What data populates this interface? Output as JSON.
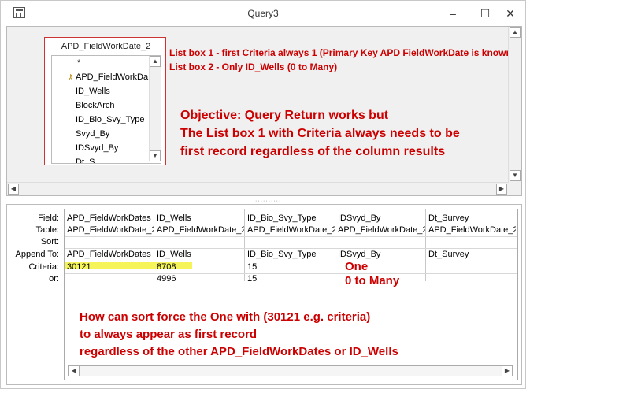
{
  "window": {
    "title": "Query3",
    "controls": {
      "minimize": "–",
      "maximize": "☐",
      "close": "✕"
    }
  },
  "table": {
    "name": "APD_FieldWorkDate_2",
    "fields": [
      {
        "label": "*",
        "icon": ""
      },
      {
        "label": "APD_FieldWorkDa",
        "icon": "key-icon"
      },
      {
        "label": "ID_Wells",
        "icon": ""
      },
      {
        "label": "BlockArch",
        "icon": ""
      },
      {
        "label": "ID_Bio_Svy_Type",
        "icon": ""
      },
      {
        "label": "Svyd_By",
        "icon": ""
      },
      {
        "label": "IDSvyd_By",
        "icon": ""
      },
      {
        "label": "Dt_S...",
        "icon": ""
      }
    ]
  },
  "notes": {
    "line1": "List box 1 - first Criteria always 1 (Primary Key APD FieldWorkDate is known",
    "line2": "List box 2 - Only ID_Wells (0 to Many)",
    "objective1": "Objective: Query Return works but",
    "objective2": "The List box 1 with Criteria always needs to be",
    "objective3": "first record regardless of the column results",
    "one": "One",
    "zero_to_many": "0 to Many",
    "question1": "How can sort force the One with (30121 e.g. criteria)",
    "question2": "to always appear as first record",
    "question3": "regardless of the other APD_FieldWorkDates or ID_Wells"
  },
  "grid": {
    "row_labels": [
      "Field:",
      "Table:",
      "Sort:",
      "Append To:",
      "Criteria:",
      "or:"
    ],
    "columns": [
      {
        "field": "APD_FieldWorkDates",
        "table": "APD_FieldWorkDate_2",
        "sort": "",
        "append": "APD_FieldWorkDates",
        "criteria": "30121",
        "or": ""
      },
      {
        "field": "ID_Wells",
        "table": "APD_FieldWorkDate_2",
        "sort": "",
        "append": "ID_Wells",
        "criteria": "8708",
        "or": "4996"
      },
      {
        "field": "ID_Bio_Svy_Type",
        "table": "APD_FieldWorkDate_2",
        "sort": "",
        "append": "ID_Bio_Svy_Type",
        "criteria": "15",
        "or": "15"
      },
      {
        "field": "IDSvyd_By",
        "table": "APD_FieldWorkDate_2",
        "sort": "",
        "append": "IDSvyd_By",
        "criteria": "",
        "or": ""
      },
      {
        "field": "Dt_Survey",
        "table": "APD_FieldWorkDate_2",
        "sort": "",
        "append": "Dt_Survey",
        "criteria": "",
        "or": ""
      }
    ]
  },
  "colors": {
    "annotation": "#cc0000",
    "highlight": "#f5f55a",
    "table_border": "#cc3333"
  }
}
